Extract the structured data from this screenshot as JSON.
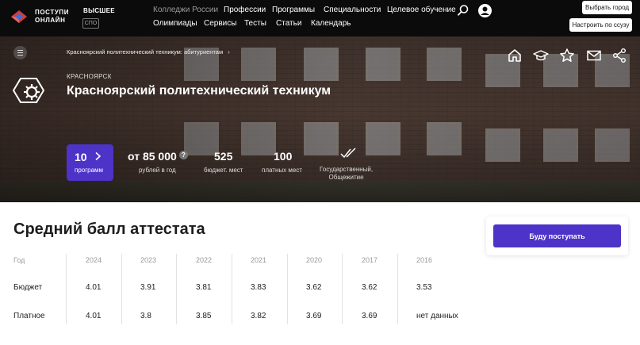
{
  "header": {
    "logo_line1": "ПОСТУПИ",
    "logo_line2": "ОНЛАЙН",
    "level_high": "ВЫСШЕЕ",
    "level_spo": "СПО",
    "nav_row1": [
      "Колледжи России",
      "Профессии",
      "Программы",
      "Специальности",
      "Целевое обучение"
    ],
    "nav_row2": [
      "Олимпиады",
      "Сервисы",
      "Тесты",
      "Статьи",
      "Календарь"
    ],
    "choose_city": "Выбрать город",
    "setup_ssuz": "Настроить по ссузу",
    "icons": [
      "search-icon",
      "user-icon"
    ]
  },
  "hero": {
    "breadcrumb": "Красноярский политехнический техникум: абитуриентам",
    "breadcrumb_sep": "›",
    "city": "КРАСНОЯРСК",
    "college_name": "Красноярский политехнический техникум",
    "action_icons": [
      "home-icon",
      "graduation-cap-icon",
      "star-icon",
      "mail-icon",
      "share-icon"
    ],
    "programs_count": "10",
    "programs_label": "программ",
    "price_value": "от 85 000",
    "price_label": "рублей в год",
    "price_help": "?",
    "budget_value": "525",
    "budget_label": "бюджет. мест",
    "paid_value": "100",
    "paid_label": "платных мест",
    "type_line1": "Государственный,",
    "type_line2": "Общежитие"
  },
  "main": {
    "title": "Средний балл аттестата",
    "cta": "Буду поступать",
    "table": {
      "year_header": "Год",
      "years": [
        "2024",
        "2023",
        "2022",
        "2021",
        "2020",
        "2017",
        "2016"
      ],
      "rows": [
        {
          "label": "Бюджет",
          "values": [
            "4.01",
            "3.91",
            "3.81",
            "3.83",
            "3.62",
            "3.62",
            "3.53"
          ]
        },
        {
          "label": "Платное",
          "values": [
            "4.01",
            "3.8",
            "3.85",
            "3.82",
            "3.69",
            "3.69",
            "нет данных"
          ]
        }
      ]
    }
  },
  "colors": {
    "accent": "#4d33c8",
    "topbar": "#0b0b0b"
  }
}
